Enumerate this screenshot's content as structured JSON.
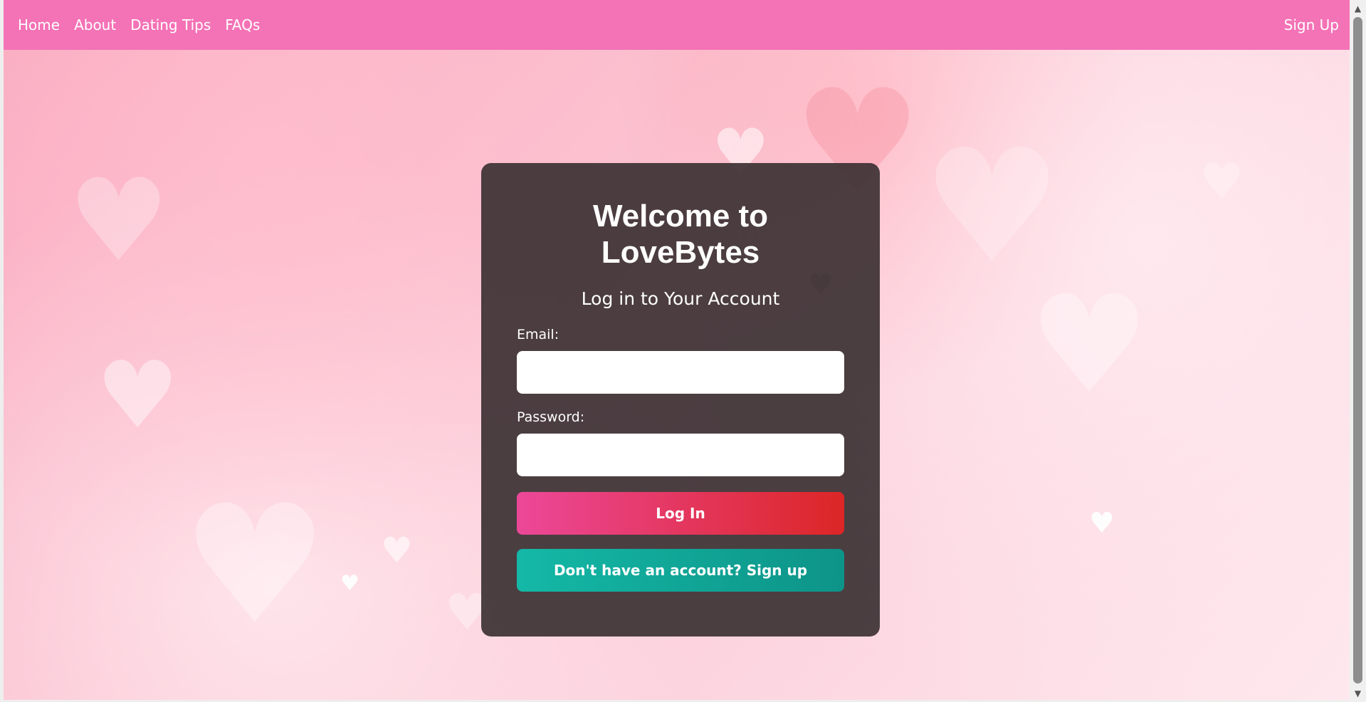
{
  "nav": {
    "links": [
      "Home",
      "About",
      "Dating Tips",
      "FAQs"
    ],
    "signup_label": "Sign Up"
  },
  "login": {
    "title": "Welcome to LoveBytes",
    "subtitle": "Log in to Your Account",
    "email_label": "Email:",
    "email_value": "",
    "password_label": "Password:",
    "password_value": "",
    "login_button": "Log In",
    "signup_button": "Don't have an account? Sign up"
  },
  "colors": {
    "nav_bg": "#f472b6",
    "card_bg": "#372d30",
    "login_gradient_start": "#ec4899",
    "login_gradient_end": "#dc2626",
    "signup_gradient_start": "#14b8a6",
    "signup_gradient_end": "#0d9488"
  },
  "icons": {
    "background_decor": "heart-icon",
    "scroll_up": "chevron-up-icon",
    "scroll_down": "chevron-down-icon"
  }
}
